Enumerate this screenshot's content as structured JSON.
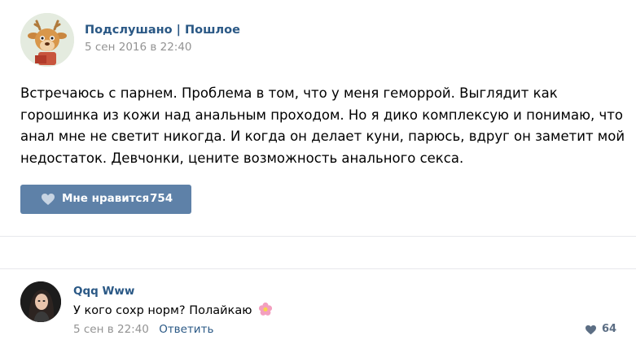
{
  "post": {
    "group_name": "Подслушано | Пошлое",
    "date": "5 сен 2016 в 22:40",
    "text_lines": [
      "Встречаюсь с парнем. Проблема в том, что у меня геморрой. Выглядит как",
      "горошинка из кожи над анальным проходом. Но я дико комплексую и понимаю, что",
      "анал мне не светит никогда. И когда он делает куни, парюсь, вдруг он заметит мой",
      "недостаток. Девчонки, цените возможность анального секса."
    ],
    "like_label": "Мне нравится",
    "like_count": "754"
  },
  "comment": {
    "author": "Qqq Www",
    "text": "У кого сохр норм? Полайкаю",
    "emoji_icon": "flower-icon",
    "date": "5 сен в 22:40",
    "reply_label": "Ответить",
    "like_count": "64"
  },
  "colors": {
    "link": "#2a5885",
    "like_button": "#5e81a8",
    "muted": "#939393",
    "divider": "#e7e8ec"
  }
}
